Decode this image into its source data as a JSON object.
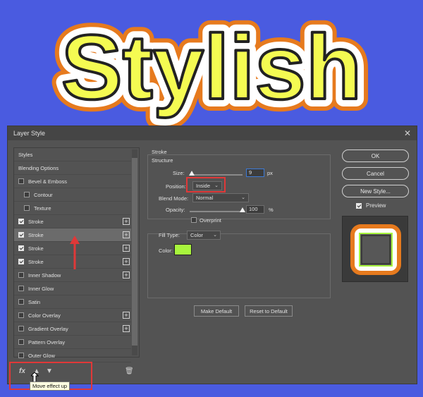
{
  "banner": {
    "text": "Stylish"
  },
  "dialog": {
    "title": "Layer Style",
    "close_label": "✕",
    "styles_list": [
      {
        "label": "Styles",
        "checkbox": false,
        "indent": false,
        "plus": false,
        "selected": false
      },
      {
        "label": "Blending Options",
        "checkbox": false,
        "indent": false,
        "plus": false,
        "selected": false
      },
      {
        "label": "Bevel & Emboss",
        "checkbox": true,
        "checked": false,
        "indent": false,
        "plus": false,
        "selected": false
      },
      {
        "label": "Contour",
        "checkbox": true,
        "checked": false,
        "indent": true,
        "plus": false,
        "selected": false
      },
      {
        "label": "Texture",
        "checkbox": true,
        "checked": false,
        "indent": true,
        "plus": false,
        "selected": false
      },
      {
        "label": "Stroke",
        "checkbox": true,
        "checked": true,
        "indent": false,
        "plus": true,
        "selected": false
      },
      {
        "label": "Stroke",
        "checkbox": true,
        "checked": true,
        "indent": false,
        "plus": true,
        "selected": true
      },
      {
        "label": "Stroke",
        "checkbox": true,
        "checked": true,
        "indent": false,
        "plus": true,
        "selected": false
      },
      {
        "label": "Stroke",
        "checkbox": true,
        "checked": true,
        "indent": false,
        "plus": true,
        "selected": false
      },
      {
        "label": "Inner Shadow",
        "checkbox": true,
        "checked": false,
        "indent": false,
        "plus": true,
        "selected": false
      },
      {
        "label": "Inner Glow",
        "checkbox": true,
        "checked": false,
        "indent": false,
        "plus": false,
        "selected": false
      },
      {
        "label": "Satin",
        "checkbox": true,
        "checked": false,
        "indent": false,
        "plus": false,
        "selected": false
      },
      {
        "label": "Color Overlay",
        "checkbox": true,
        "checked": false,
        "indent": false,
        "plus": true,
        "selected": false
      },
      {
        "label": "Gradient Overlay",
        "checkbox": true,
        "checked": false,
        "indent": false,
        "plus": true,
        "selected": false
      },
      {
        "label": "Pattern Overlay",
        "checkbox": true,
        "checked": false,
        "indent": false,
        "plus": false,
        "selected": false
      },
      {
        "label": "Outer Glow",
        "checkbox": true,
        "checked": false,
        "indent": false,
        "plus": false,
        "selected": false
      }
    ],
    "toolbar": {
      "fx_label": "fx",
      "move_up_icon": "▲",
      "move_down_icon": "▼",
      "trash_icon": "🗑",
      "tooltip": "Move effect up"
    },
    "stroke": {
      "section_title": "Stroke",
      "structure_title": "Structure",
      "size_label": "Size:",
      "size_value": "9",
      "size_unit": "px",
      "size_fraction": 0.04,
      "position_label": "Position:",
      "position_value": "Inside",
      "blend_mode_label": "Blend Mode:",
      "blend_mode_value": "Normal",
      "opacity_label": "Opacity:",
      "opacity_value": "100",
      "opacity_unit": "%",
      "overprint_label": "Overprint",
      "fill_type_label": "Fill Type:",
      "fill_type_value": "Color",
      "color_label": "Color:",
      "color_hex": "#a8f53d",
      "make_default": "Make Default",
      "reset_default": "Reset to Default"
    },
    "right": {
      "ok": "OK",
      "cancel": "Cancel",
      "new_style": "New Style...",
      "preview_label": "Preview",
      "preview_checked": true
    }
  },
  "colors": {
    "background": "#4a5be0",
    "banner_fill": "#f4fb52",
    "banner_outline": "#e67a1e",
    "highlight": "#e03838",
    "preview_ring": "#e67a1e",
    "preview_inner": "#a8f53d"
  }
}
